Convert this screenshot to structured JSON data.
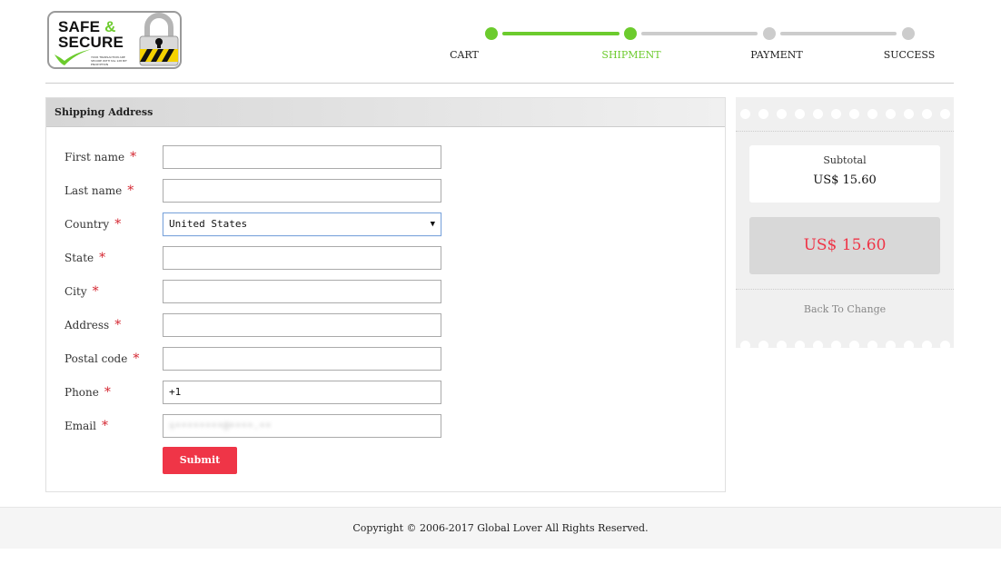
{
  "logo": {
    "line1_a": "SAFE",
    "line1_amp": "&",
    "line2": "SECURE",
    "tagline": "YOUR TRANSACTION ARE SECURE WITH SSL 128 BIT ENCRYPTION"
  },
  "steps": [
    {
      "label": "CART",
      "state": "done"
    },
    {
      "label": "SHIPMENT",
      "state": "active"
    },
    {
      "label": "PAYMENT",
      "state": "pending"
    },
    {
      "label": "SUCCESS",
      "state": "pending"
    }
  ],
  "colors": {
    "accent": "#6ccb2d",
    "price": "#ef3547",
    "inactive": "#cccccc"
  },
  "form": {
    "title": "Shipping Address",
    "required_mark": "*",
    "fields": [
      {
        "label": "First name",
        "value": ""
      },
      {
        "label": "Last name",
        "value": ""
      },
      {
        "label": "Country",
        "value": "United States"
      },
      {
        "label": "State",
        "value": ""
      },
      {
        "label": "City",
        "value": ""
      },
      {
        "label": "Address",
        "value": ""
      },
      {
        "label": "Postal code",
        "value": ""
      },
      {
        "label": "Phone",
        "value": "+1"
      },
      {
        "label": "Email",
        "value": "s••••••••@••••.••"
      }
    ],
    "country_arrow": "▼",
    "submit_label": "Submit"
  },
  "summary": {
    "subtotal_label": "Subtotal",
    "subtotal_value": "US$ 15.60",
    "total_value": "US$ 15.60",
    "back_label": "Back To Change"
  },
  "footer": {
    "copyright": "Copyright © 2006-2017 Global Lover All Rights Reserved."
  }
}
